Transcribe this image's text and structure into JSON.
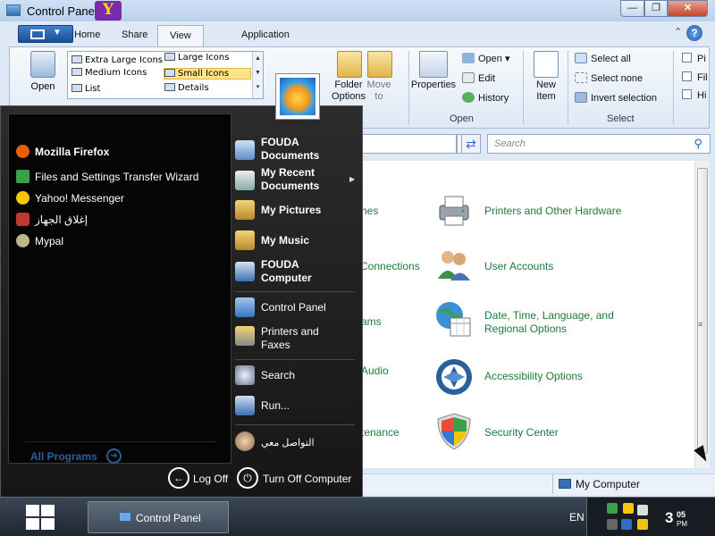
{
  "window": {
    "title": "Control Panel",
    "caption_buttons": {
      "minimize": "—",
      "maximize": "❐",
      "close": "✕"
    }
  },
  "ribbon": {
    "tabs": [
      "Home",
      "Share",
      "View",
      "Application"
    ],
    "active_tab": "View",
    "open_label": "Open",
    "layout": {
      "extra_large": "Extra Large Icons",
      "large": "Large Icons",
      "medium": "Medium Icons",
      "small": "Small Icons",
      "list": "List",
      "details": "Details"
    },
    "folder_options": "Folder Options",
    "move_to": "Move to",
    "properties": "Properties",
    "open_menu": "Open",
    "edit": "Edit",
    "history": "History",
    "new_item": "New Item",
    "open_group": "Open",
    "select_all": "Select all",
    "select_none": "Select none",
    "invert_selection": "Invert selection",
    "select_group": "Select",
    "pi_partial": "Pi",
    "fil_partial": "Fil",
    "hi_partial": "Hi"
  },
  "search": {
    "placeholder": "Search"
  },
  "content": {
    "left_partials": [
      "hes",
      "Connections",
      "ams",
      "Audio",
      "tenance"
    ],
    "categories": [
      {
        "label": "Printers and Other Hardware",
        "icon": "printer-icon"
      },
      {
        "label": "User Accounts",
        "icon": "users-icon"
      },
      {
        "label": "Date, Time, Language, and Regional Options",
        "icon": "globe-calendar-icon"
      },
      {
        "label": "Accessibility Options",
        "icon": "accessibility-icon"
      },
      {
        "label": "Security Center",
        "icon": "shield-icon"
      }
    ]
  },
  "statusbar": {
    "location": "My Computer"
  },
  "startmenu": {
    "programs": [
      {
        "label": "Mozilla Firefox",
        "bold": true,
        "color": "#e66000"
      },
      {
        "label": "Files and Settings Transfer Wizard",
        "bold": false,
        "color": "#3aa14a"
      },
      {
        "label": "Yahoo! Messenger",
        "bold": false,
        "color": "#f7c600"
      },
      {
        "label": "إغلاق الجهاز",
        "bold": false,
        "color": "#c0392b"
      },
      {
        "label": "Mypal",
        "bold": false,
        "color": "#bdb58c"
      }
    ],
    "all_programs": "All Programs",
    "places": {
      "documents_line1": "FOUDA",
      "documents_line2": "Documents",
      "recent_line1": "My Recent",
      "recent_line2": "Documents",
      "pictures": "My Pictures",
      "music": "My Music",
      "computer_line1": "FOUDA",
      "computer_line2": "Computer",
      "control_panel": "Control Panel",
      "printers_line1": "Printers and",
      "printers_line2": "Faxes",
      "search": "Search",
      "run": "Run...",
      "contact": "التواصل معي"
    },
    "log_off": "Log Off",
    "turn_off": "Turn Off Computer"
  },
  "taskbar": {
    "task_label": "Control Panel",
    "language": "EN",
    "clock_hour": "3",
    "clock_minute": "05",
    "clock_ampm": "PM"
  },
  "colors": {
    "accent": "#1c5fb7",
    "category_text": "#1e7a3c",
    "start_link": "#2a5f9a"
  }
}
